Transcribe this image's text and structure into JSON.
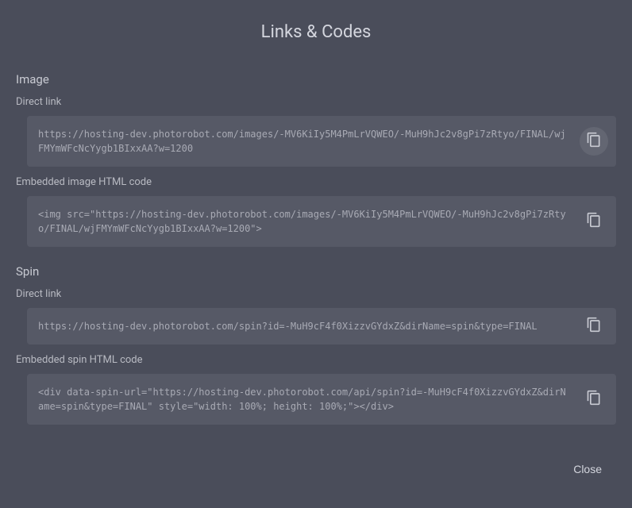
{
  "title": "Links & Codes",
  "sections": {
    "image": {
      "heading": "Image",
      "directLink": {
        "label": "Direct link",
        "value": "https://hosting-dev.photorobot.com/images/-MV6KiIy5M4PmLrVQWEO/-MuH9hJc2v8gPi7zRtyo/FINAL/wjFMYmWFcNcYygb1BIxxAA?w=1200"
      },
      "embedded": {
        "label": "Embedded image HTML code",
        "value": "<img src=\"https://hosting-dev.photorobot.com/images/-MV6KiIy5M4PmLrVQWEO/-MuH9hJc2v8gPi7zRtyo/FINAL/wjFMYmWFcNcYygb1BIxxAA?w=1200\">"
      }
    },
    "spin": {
      "heading": "Spin",
      "directLink": {
        "label": "Direct link",
        "value": "https://hosting-dev.photorobot.com/spin?id=-MuH9cF4f0XizzvGYdxZ&dirName=spin&type=FINAL"
      },
      "embedded": {
        "label": "Embedded spin HTML code",
        "value": "<div data-spin-url=\"https://hosting-dev.photorobot.com/api/spin?id=-MuH9cF4f0XizzvGYdxZ&dirName=spin&type=FINAL\" style=\"width: 100%; height: 100%;\"></div>"
      }
    }
  },
  "footer": {
    "close_label": "Close"
  }
}
